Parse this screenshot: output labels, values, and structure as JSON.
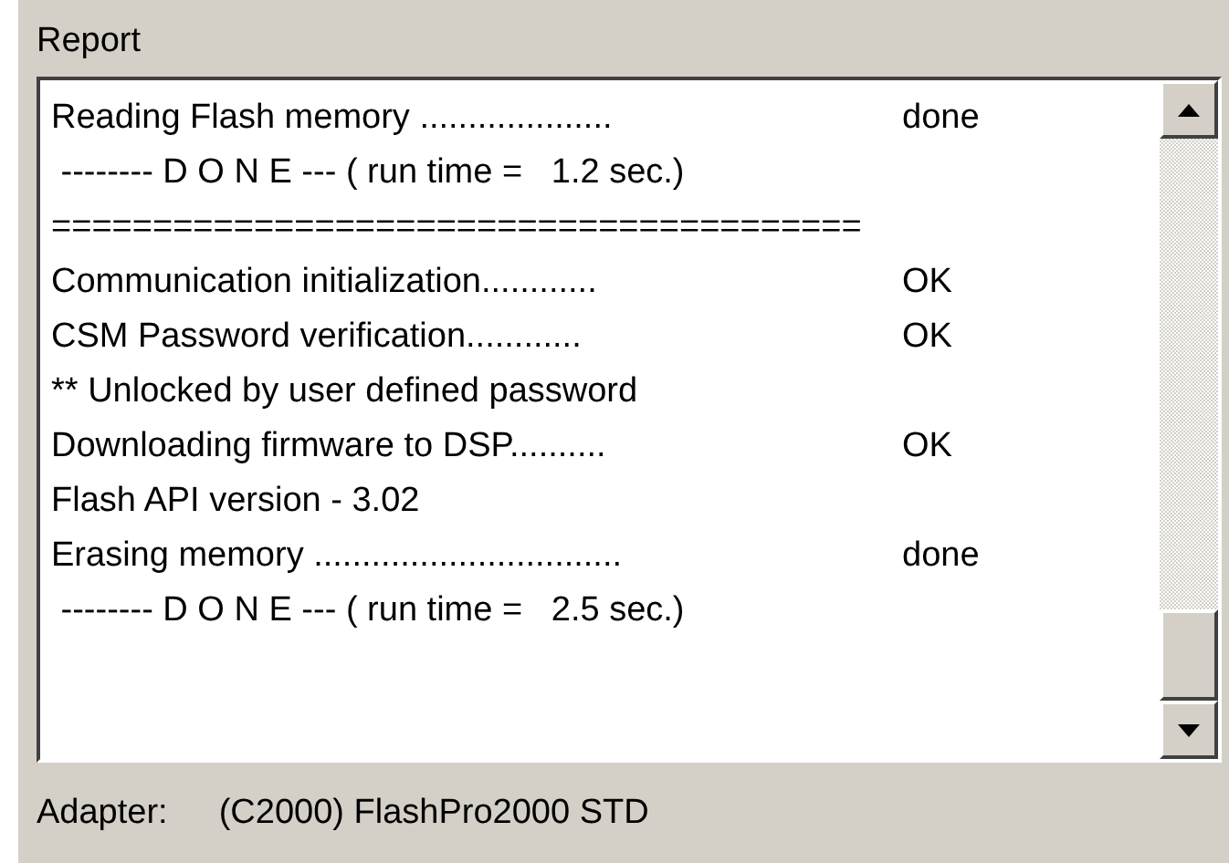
{
  "report": {
    "label": "Report",
    "lines": [
      {
        "text": "Reading Flash memory ....................",
        "result": "done"
      },
      {
        "text": " -------- D O N E --- ( run time =   1.2 sec.)"
      },
      {
        "text": "========================================"
      },
      {
        "text": "Communication initialization............",
        "result": "OK"
      },
      {
        "text": "CSM Password verification............",
        "result": "OK"
      },
      {
        "text": "** Unlocked by user defined password"
      },
      {
        "text": "Downloading firmware to DSP..........",
        "result": "OK"
      },
      {
        "text": "Flash API version - 3.02"
      },
      {
        "text": "Erasing memory ................................",
        "result": "done"
      },
      {
        "text": " -------- D O N E --- ( run time =   2.5 sec.)"
      }
    ]
  },
  "status_bar": {
    "label": "Adapter:",
    "value": "(C2000)  FlashPro2000 STD"
  }
}
